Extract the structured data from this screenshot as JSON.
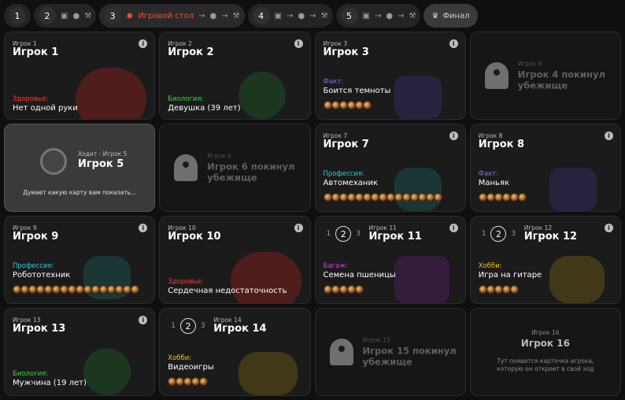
{
  "topbar": {
    "steps": [
      {
        "num": "1"
      },
      {
        "num": "2"
      },
      {
        "num": "3",
        "label": "Игровой стол"
      },
      {
        "num": "4"
      },
      {
        "num": "5"
      }
    ],
    "final_label": "Финал"
  },
  "colors": {
    "health": "#ff3b30",
    "biology": "#3fcf4a",
    "fact": "#7a6cff",
    "profession": "#2ad1c9",
    "baggage": "#c84bd6",
    "hobby": "#f2c21b"
  },
  "cards": [
    {
      "small": "Игрок 1",
      "name": "Игрок 1",
      "cat": "Здоровье:",
      "val": "Нет одной руки",
      "color": "#ff3b30"
    },
    {
      "small": "Игрок 2",
      "name": "Игрок 2",
      "cat": "Биология:",
      "val": "Девушка (39 лет)",
      "color": "#3fcf4a"
    },
    {
      "small": "Игрок 3",
      "name": "Игрок 3",
      "cat": "Факт:",
      "val": "Боится темноты",
      "color": "#7a6cff"
    },
    {
      "small": "Игрок 4",
      "msg": "Игрок 4 покинул убежище"
    },
    {
      "small": "Ходит - Игрок 5",
      "name": "Игрок 5",
      "status": "Думает какую карту вам показать..."
    },
    {
      "small": "Игрок 6",
      "msg": "Игрок 6 покинул убежище"
    },
    {
      "small": "Игрок 7",
      "name": "Игрок 7",
      "cat": "Профессия:",
      "val": "Автомеханик",
      "color": "#2ad1c9"
    },
    {
      "small": "Игрок 8",
      "name": "Игрок 8",
      "cat": "Факт:",
      "val": "Маньяк",
      "color": "#7a6cff"
    },
    {
      "small": "Игрок 9",
      "name": "Игрок 9",
      "cat": "Профессия:",
      "val": "Робототехник",
      "color": "#2ad1c9"
    },
    {
      "small": "Игрок 10",
      "name": "Игрок 10",
      "cat": "Здоровье:",
      "val": "Сердечная недостаточность",
      "color": "#ff3b30"
    },
    {
      "small": "Игрок 11",
      "name": "Игрок 11",
      "cat": "Багаж:",
      "val": "Семена пшеницы",
      "color": "#c84bd6"
    },
    {
      "small": "Игрок 12",
      "name": "Игрок 12",
      "cat": "Хобби:",
      "val": "Игра на гитаре",
      "color": "#f2c21b"
    },
    {
      "small": "Игрок 13",
      "name": "Игрок 13",
      "cat": "Биология:",
      "val": "Мужчина (19 лет)",
      "color": "#3fcf4a"
    },
    {
      "small": "Игрок 14",
      "name": "Игрок 14",
      "cat": "Хобби:",
      "val": "Видеоигры",
      "color": "#f2c21b"
    },
    {
      "small": "Игрок 15",
      "msg": "Игрок 15 покинул убежище"
    },
    {
      "small": "Игрок 16",
      "name": "Игрок 16",
      "status": "Тут появится карточка игрока, которую он откроет в свой ход"
    }
  ],
  "round": {
    "prev": "1",
    "cur": "2",
    "next": "3"
  },
  "info_icon": "i"
}
